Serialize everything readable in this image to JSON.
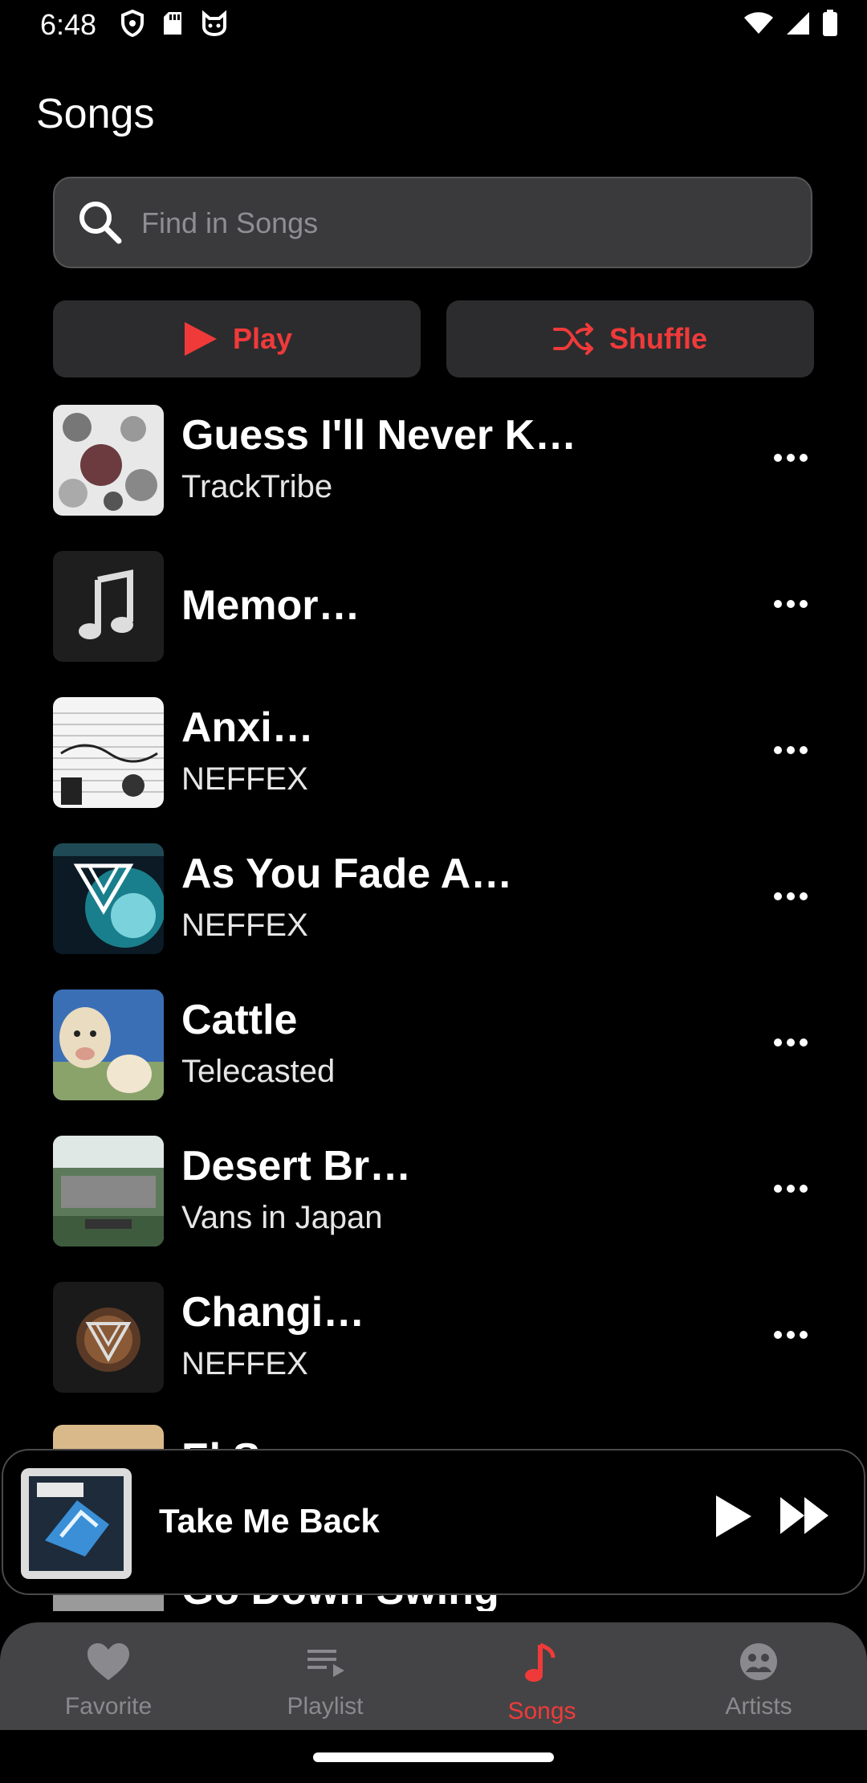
{
  "status": {
    "time": "6:48"
  },
  "header": {
    "title": "Songs"
  },
  "search": {
    "placeholder": "Find in Songs"
  },
  "actions": {
    "play_label": "Play",
    "shuffle_label": "Shuffle"
  },
  "songs": [
    {
      "title": "Guess I'll Never K…",
      "artist": "TrackTribe"
    },
    {
      "title": "Memor…",
      "artist": ""
    },
    {
      "title": "Anxi…",
      "artist": "NEFFEX"
    },
    {
      "title": "As You Fade A…",
      "artist": "NEFFEX"
    },
    {
      "title": "Cattle",
      "artist": "Telecasted"
    },
    {
      "title": "Desert Br…",
      "artist": "Vans in Japan"
    },
    {
      "title": "Changi…",
      "artist": "NEFFEX"
    },
    {
      "title": "El S…",
      "artist": ""
    },
    {
      "title": "Go Down Swing",
      "artist": ""
    }
  ],
  "now_playing": {
    "title": "Take Me Back"
  },
  "tabs": [
    {
      "label": "Favorite",
      "icon": "heart-icon"
    },
    {
      "label": "Playlist",
      "icon": "playlist-icon"
    },
    {
      "label": "Songs",
      "icon": "music-note-icon"
    },
    {
      "label": "Artists",
      "icon": "artists-icon"
    }
  ],
  "colors": {
    "accent": "#f03a3a",
    "background": "#000000",
    "surface": "#2c2c2e"
  }
}
